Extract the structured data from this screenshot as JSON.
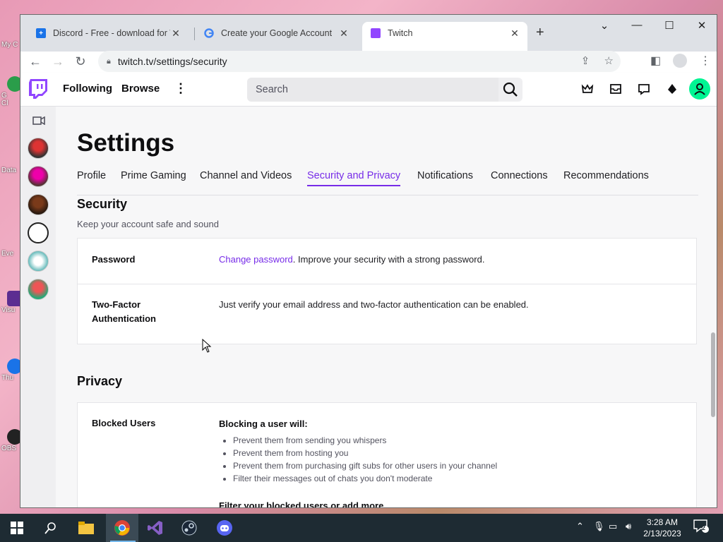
{
  "desktop": {
    "icons": [
      "My C",
      "G\nCl",
      "Data",
      "Eve",
      "Visu",
      "Thu",
      "OBS"
    ]
  },
  "browser": {
    "tabs": [
      {
        "title": "Discord - Free - download for W",
        "icon": "discord-favicon"
      },
      {
        "title": "Create your Google Account",
        "icon": "google-favicon"
      },
      {
        "title": "Twitch",
        "icon": "twitch-favicon",
        "active": true
      }
    ],
    "url": "twitch.tv/settings/security",
    "window_controls": [
      "chevron-down-icon",
      "minimize-icon",
      "maximize-icon",
      "close-icon"
    ]
  },
  "twitch": {
    "nav": {
      "following": "Following",
      "browse": "Browse",
      "search_placeholder": "Search"
    },
    "settings": {
      "title": "Settings",
      "tabs": [
        "Profile",
        "Prime Gaming",
        "Channel and Videos",
        "Security and Privacy",
        "Notifications",
        "Connections",
        "Recommendations"
      ],
      "active_tab": "Security and Privacy",
      "security": {
        "heading": "Security",
        "subheading": "Keep your account safe and sound",
        "password_label": "Password",
        "password_link": "Change password",
        "password_text": ". Improve your security with a strong password.",
        "twofa_label": "Two-Factor Authentication",
        "twofa_text": "Just verify your email address and two-factor authentication can be enabled."
      },
      "privacy": {
        "heading": "Privacy",
        "blocked_label": "Blocked Users",
        "blocking_title": "Blocking a user will:",
        "bullets": [
          "Prevent them from sending you whispers",
          "Prevent them from hosting you",
          "Prevent them from purchasing gift subs for other users in your channel",
          "Filter their messages out of chats you don't moderate"
        ],
        "filter_title": "Filter your blocked users or add more"
      }
    }
  },
  "taskbar": {
    "time": "3:28 AM",
    "date": "2/13/2023",
    "notification_count": "2"
  },
  "colors": {
    "twitch_purple": "#772ce8",
    "user_avatar": "#00f593",
    "taskbar": "#1e2b33"
  }
}
